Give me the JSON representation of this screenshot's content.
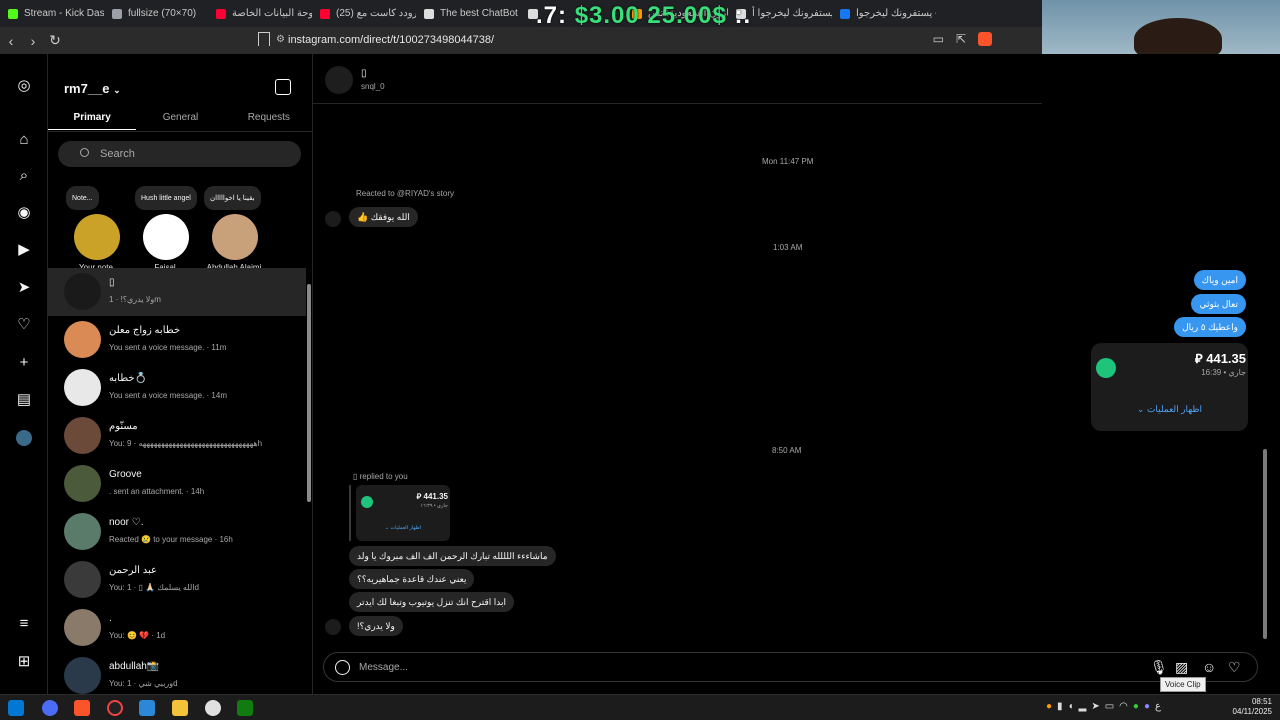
{
  "browser": {
    "tabs": [
      {
        "label": "Stream - Kick Dashb",
        "color": "#53fc18"
      },
      {
        "label": "fullsize (70×70)",
        "color": "#9aa0a6"
      },
      {
        "label": "لوحة البيانات الخاصة",
        "color": "#ff0033"
      },
      {
        "label": "(25) برودد كاست مع",
        "color": "#ff0033"
      },
      {
        "label": "The best ChatBot in",
        "color": "#dddddd"
      },
      {
        "label": "",
        "color": "#dddddd"
      },
      {
        "label": "أمازون السعودية: تس",
        "color": "#ff9900"
      },
      {
        "label": "يستفرونك ليخرجوا أ",
        "color": "#dddddd"
      },
      {
        "label": "يستفرونك ليخرجوا -",
        "color": "#1877f2"
      }
    ],
    "price_overlay": {
      "left": ".7: ",
      "mid": "$3.00",
      "sep": " ",
      "right": "25.00$",
      "tail": " :."
    },
    "url": "instagram.com/direct/t/100273498044738/"
  },
  "ig": {
    "account": "rm7__e",
    "tabs": {
      "primary": "Primary",
      "general": "General",
      "requests": "Requests"
    },
    "search_placeholder": "Search",
    "notes": [
      {
        "bubble": "Note...",
        "name": "Your note",
        "color": "#c9a227"
      },
      {
        "bubble": "Hush little angel",
        "name": "Faisal",
        "color": "#ffffff"
      },
      {
        "bubble": "بقينا يا اخوااااان",
        "name": "Abdullah Alajmi",
        "color": "#c8a07a"
      }
    ],
    "conversations": [
      {
        "name": "▯",
        "preview": "ولا يدري؟! · 1m",
        "color": "#1a1a1a"
      },
      {
        "name": "خطابه زواج معلن",
        "preview": "You sent a voice message. · 11m",
        "color": "#d98a55"
      },
      {
        "name": "خطابه💍",
        "preview": "You sent a voice message. · 14m",
        "color": "#e8e8e8"
      },
      {
        "name": "مسنّوم",
        "preview": "You: هههههههههههههههههههههههههههههههه · 9h",
        "color": "#6b4a3a"
      },
      {
        "name": "Groove",
        "preview": ". sent an attachment. · 14h",
        "color": "#4a5a3a"
      },
      {
        "name": "noor ♡.",
        "preview": "Reacted 😢 to your message · 16h",
        "color": "#5a7a6a"
      },
      {
        "name": "عبد الرحمن",
        "preview": "You: الله يسلمك 🙏🏻 ▯ · 1d",
        "color": "#3a3a3a"
      },
      {
        "name": ".",
        "preview": "You: 😊 💔 · 1d",
        "color": "#8a7a6a"
      },
      {
        "name": "abdullah📸",
        "preview": "You: ورببي شي · 1d",
        "color": "#2a3a4a"
      }
    ]
  },
  "chat": {
    "title": "▯",
    "subtitle": "snql_0",
    "ts1": "Mon 11:47 PM",
    "story_ctx": "Reacted to @RIYAD's story",
    "story_reply": "الله يوفقك 👍",
    "ts2": "1:03 AM",
    "sent": [
      "امين وياك",
      "تعال بثوثي",
      "واعطيك ٥ ريال"
    ],
    "card": {
      "amount": "441.35 ⃁",
      "sub": "جاري • 16:39",
      "link": "اظهار العمليات ⌄"
    },
    "ts3": "8:50 AM",
    "reply_ctx": "▯ replied to you",
    "mini_card": {
      "amount": "441.35 ⃁",
      "sub": "جاري • ١٦:٣٩",
      "link": "اظهار العمليات ⌄"
    },
    "received": [
      "ماشاءءء اللللله تبارك الرحمن الف الف مبروك يا ولد",
      "يعني عندك قاعدة جماهيريه؟؟",
      "ابدا اقترح انك تنزل يوتيوب وتبغا لك ايدتر",
      "ولا يدري؟!"
    ],
    "composer_placeholder": "Message...",
    "tooltip": "Voice Clip"
  },
  "taskbar": {
    "time": "08:51",
    "date": "04/11/2025",
    "lang": "ع"
  }
}
